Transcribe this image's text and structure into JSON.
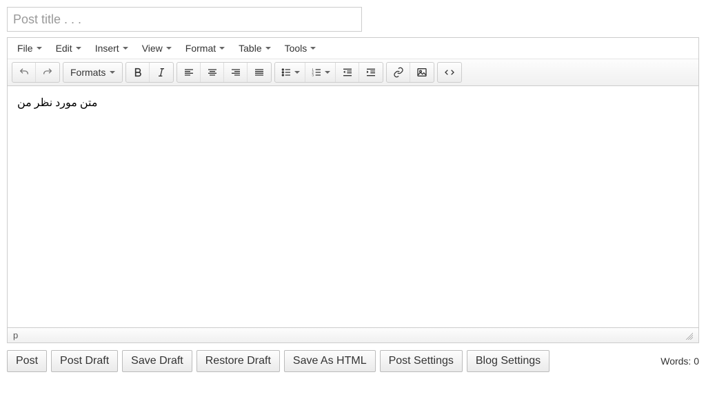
{
  "title_placeholder": "Post title . . .",
  "title_value": "",
  "menubar": {
    "file": "File",
    "edit": "Edit",
    "insert": "Insert",
    "view": "View",
    "format": "Format",
    "table": "Table",
    "tools": "Tools"
  },
  "toolbar": {
    "formats_label": "Formats"
  },
  "content": "متن مورد نظر من",
  "status": {
    "path": "p"
  },
  "actions": {
    "post": "Post",
    "post_draft": "Post Draft",
    "save_draft": "Save Draft",
    "restore_draft": "Restore Draft",
    "save_html": "Save As HTML",
    "post_settings": "Post Settings",
    "blog_settings": "Blog Settings"
  },
  "word_count_label": "Words: 0"
}
